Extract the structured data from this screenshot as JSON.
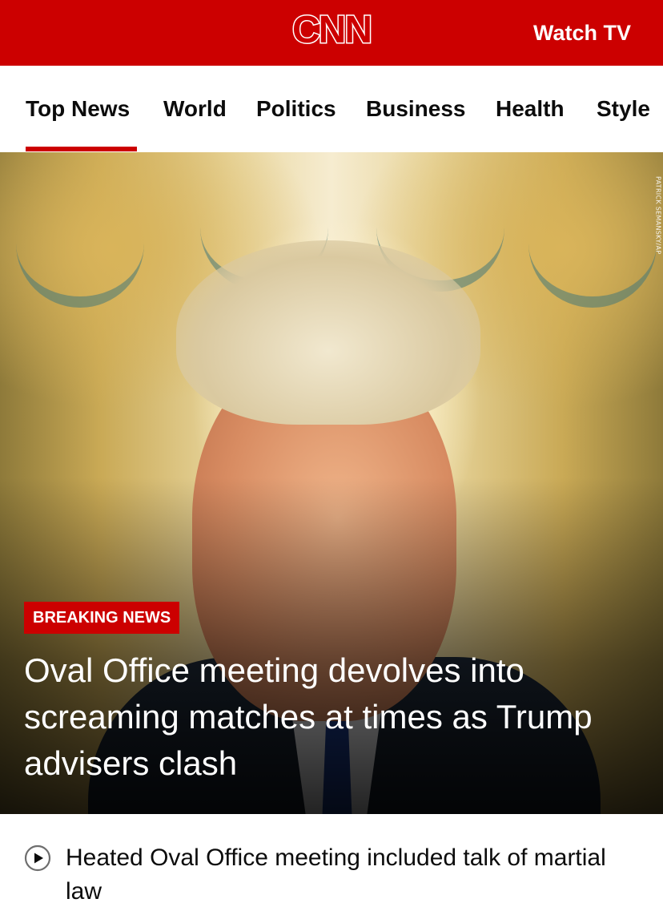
{
  "header": {
    "logo_text": "CNN",
    "watch_tv_label": "Watch TV"
  },
  "nav": {
    "items": [
      {
        "label": "Top News"
      },
      {
        "label": "World"
      },
      {
        "label": "Politics"
      },
      {
        "label": "Business"
      },
      {
        "label": "Health"
      },
      {
        "label": "Style"
      }
    ],
    "active": "Top News"
  },
  "hero": {
    "photo_credit": "PATRICK SEMANSKY/AP",
    "badge": "BREAKING NEWS",
    "headline": "Oval Office meeting devolves into screaming matches at times as Trump advisers clash"
  },
  "related": {
    "icon": "play-circle-icon",
    "text": "Heated Oval Office meeting included talk of martial law"
  },
  "colors": {
    "brand": "#cc0000",
    "text": "#0c0c0c"
  }
}
